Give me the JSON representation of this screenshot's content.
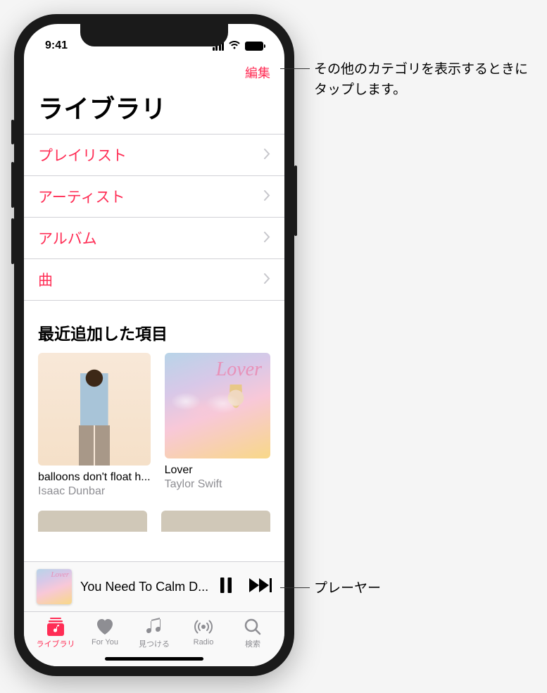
{
  "status": {
    "time": "9:41"
  },
  "nav": {
    "edit": "編集"
  },
  "page": {
    "title": "ライブラリ"
  },
  "categories": [
    {
      "label": "プレイリスト"
    },
    {
      "label": "アーティスト"
    },
    {
      "label": "アルバム"
    },
    {
      "label": "曲"
    }
  ],
  "recent": {
    "header": "最近追加した項目",
    "albums": [
      {
        "title": "balloons don't float h...",
        "artist": "Isaac Dunbar",
        "cover_text": ""
      },
      {
        "title": "Lover",
        "artist": "Taylor Swift",
        "cover_text": "Lover"
      }
    ]
  },
  "now_playing": {
    "title": "You Need To Calm D...",
    "cover_text": "Lover"
  },
  "tabs": [
    {
      "label": "ライブラリ",
      "active": true
    },
    {
      "label": "For You",
      "active": false
    },
    {
      "label": "見つける",
      "active": false
    },
    {
      "label": "Radio",
      "active": false
    },
    {
      "label": "検索",
      "active": false
    }
  ],
  "annotations": {
    "edit": "その他のカテゴリを表示するときにタップします。",
    "player": "プレーヤー"
  }
}
